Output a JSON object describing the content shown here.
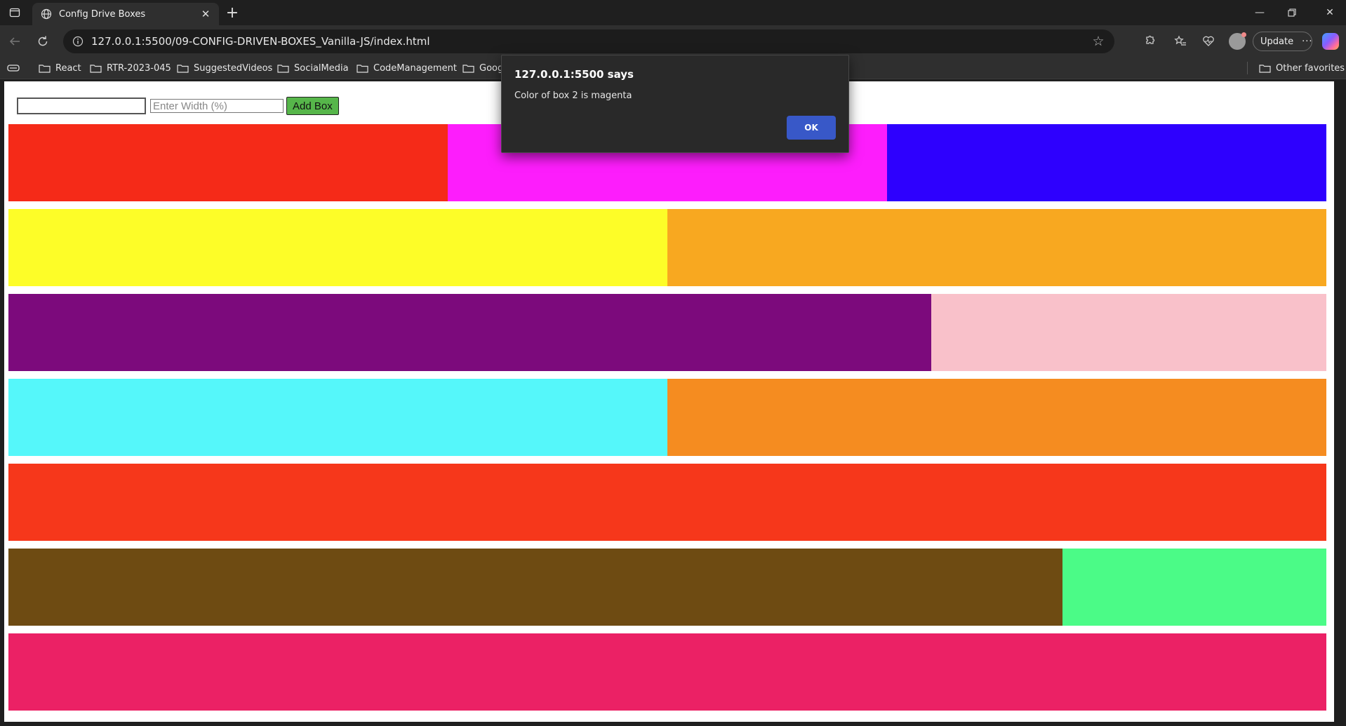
{
  "browser": {
    "tab_title": "Config Drive Boxes",
    "url": "127.0.0.1:5500/09-CONFIG-DRIVEN-BOXES_Vanilla-JS/index.html",
    "update_label": "Update",
    "favorites": [
      "React",
      "RTR-2023-045",
      "SuggestedVideos",
      "SocialMedia",
      "CodeManagement",
      "Goog"
    ],
    "other_favorites": "Other favorites"
  },
  "page": {
    "color_input_value": "",
    "width_placeholder": "Enter Width (%)",
    "add_button": "Add Box",
    "rows": [
      [
        {
          "color": "#f52a18",
          "width": 33.33
        },
        {
          "color": "#fd1dfc",
          "width": 33.33
        },
        {
          "color": "#2e00fe",
          "width": 33.34
        }
      ],
      [
        {
          "color": "#fdfd28",
          "width": 50
        },
        {
          "color": "#f8a820",
          "width": 50
        }
      ],
      [
        {
          "color": "#7c0a7c",
          "width": 70
        },
        {
          "color": "#f9c1ca",
          "width": 30
        }
      ],
      [
        {
          "color": "#55f7fa",
          "width": 50
        },
        {
          "color": "#f58c20",
          "width": 50
        }
      ],
      [
        {
          "color": "#f6371b",
          "width": 100
        }
      ],
      [
        {
          "color": "#6e4b12",
          "width": 80
        },
        {
          "color": "#4bfb87",
          "width": 20
        }
      ],
      [
        {
          "color": "#eb2165",
          "width": 100
        }
      ]
    ]
  },
  "dialog": {
    "heading": "127.0.0.1:5500 says",
    "message": "Color of box 2 is magenta",
    "ok_label": "OK"
  }
}
